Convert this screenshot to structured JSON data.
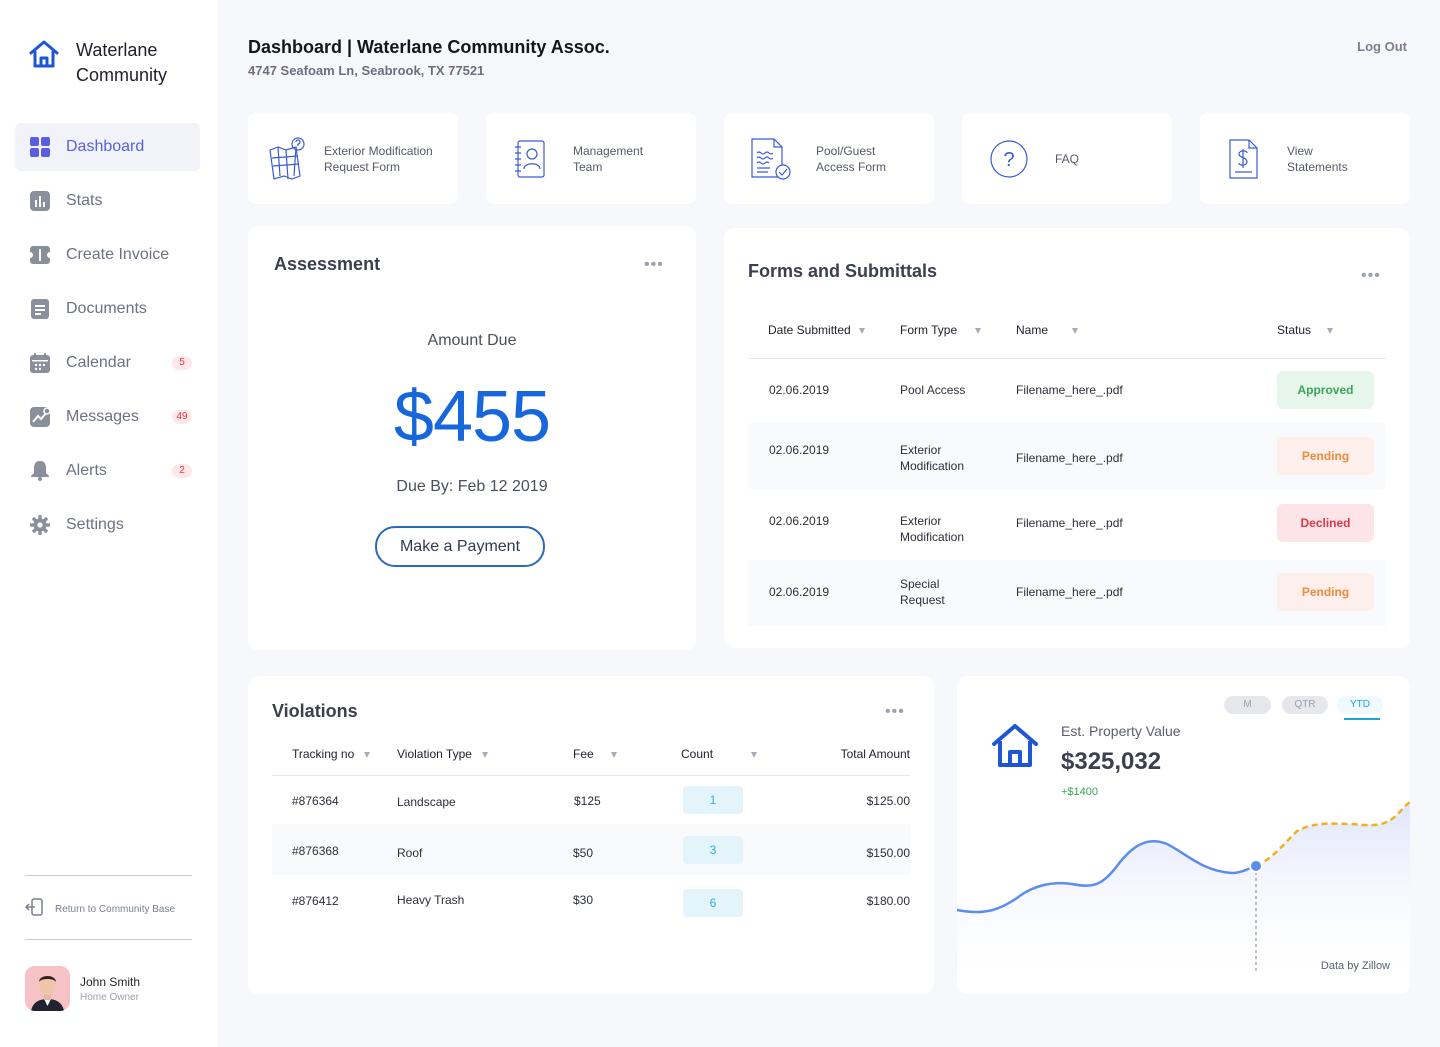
{
  "brand": {
    "line1": "Waterlane",
    "line2": "Community"
  },
  "nav": [
    {
      "label": "Dashboard",
      "icon": "grid-icon",
      "badge": ""
    },
    {
      "label": "Stats",
      "icon": "bar-chart-icon",
      "badge": ""
    },
    {
      "label": "Create Invoice",
      "icon": "ticket-icon",
      "badge": ""
    },
    {
      "label": "Documents",
      "icon": "document-icon",
      "badge": ""
    },
    {
      "label": "Calendar",
      "icon": "calendar-icon",
      "badge": "5"
    },
    {
      "label": "Messages",
      "icon": "trend-icon",
      "badge": "49"
    },
    {
      "label": "Alerts",
      "icon": "bell-icon",
      "badge": "2"
    },
    {
      "label": "Settings",
      "icon": "gear-icon",
      "badge": ""
    }
  ],
  "return_label": "Return to Community Base",
  "user": {
    "name": "John Smith",
    "role": "Home Owner"
  },
  "header": {
    "title": "Dashboard | Waterlane Community Assoc.",
    "subtitle": "4747 Seafoam Ln, Seabrook, TX 77521",
    "logout": "Log Out"
  },
  "quick_links": [
    {
      "label": "Exterior Modification\nRequest Form",
      "icon": "map-icon"
    },
    {
      "label": "Management\nTeam",
      "icon": "contact-book-icon"
    },
    {
      "label": "Pool/Guest\nAccess Form",
      "icon": "pool-form-icon"
    },
    {
      "label": "FAQ",
      "icon": "question-icon"
    },
    {
      "label": "View\nStatements",
      "icon": "statement-icon"
    }
  ],
  "assessment": {
    "title": "Assessment",
    "amount_label": "Amount Due",
    "amount": "$455",
    "due": "Due By: Feb 12 2019",
    "button": "Make a Payment"
  },
  "forms": {
    "title": "Forms and Submittals",
    "columns": [
      "Date Submitted",
      "Form Type",
      "Name",
      "Status"
    ],
    "rows": [
      {
        "date": "02.06.2019",
        "type": "Pool Access",
        "name": "Filename_here_.pdf",
        "status": "Approved"
      },
      {
        "date": "02.06.2019",
        "type": "Exterior\nModification",
        "name": "Filename_here_.pdf",
        "status": "Pending"
      },
      {
        "date": "02.06.2019",
        "type": "Exterior\nModification",
        "name": "Filename_here_.pdf",
        "status": "Declined"
      },
      {
        "date": "02.06.2019",
        "type": "Special\nRequest",
        "name": "Filename_here_.pdf",
        "status": "Pending"
      }
    ]
  },
  "violations": {
    "title": "Violations",
    "columns": [
      "Tracking no",
      "Violation Type",
      "Fee",
      "Count",
      "Total Amount"
    ],
    "rows": [
      {
        "tracking": "#876364",
        "type": "Landscape",
        "fee": "$125",
        "count": "1",
        "total": "$125.00"
      },
      {
        "tracking": "#876368",
        "type": "Roof",
        "fee": "$50",
        "count": "3",
        "total": "$150.00"
      },
      {
        "tracking": "#876412",
        "type": "Heavy Trash",
        "fee": "$30",
        "count": "6",
        "total": "$180.00"
      }
    ]
  },
  "property": {
    "tabs": [
      "M",
      "QTR",
      "YTD"
    ],
    "active_tab": "YTD",
    "label": "Est. Property Value",
    "value": "$325,032",
    "change": "+$1400",
    "source": "Data by Zillow"
  },
  "colors": {
    "accent": "#5a5fe0",
    "amount": "#1667dc",
    "chart_line": "#5b8def",
    "chart_projection": "#f2b01e",
    "approved": "#3aa55a",
    "pending": "#f08b3a",
    "declined": "#e0384a"
  }
}
